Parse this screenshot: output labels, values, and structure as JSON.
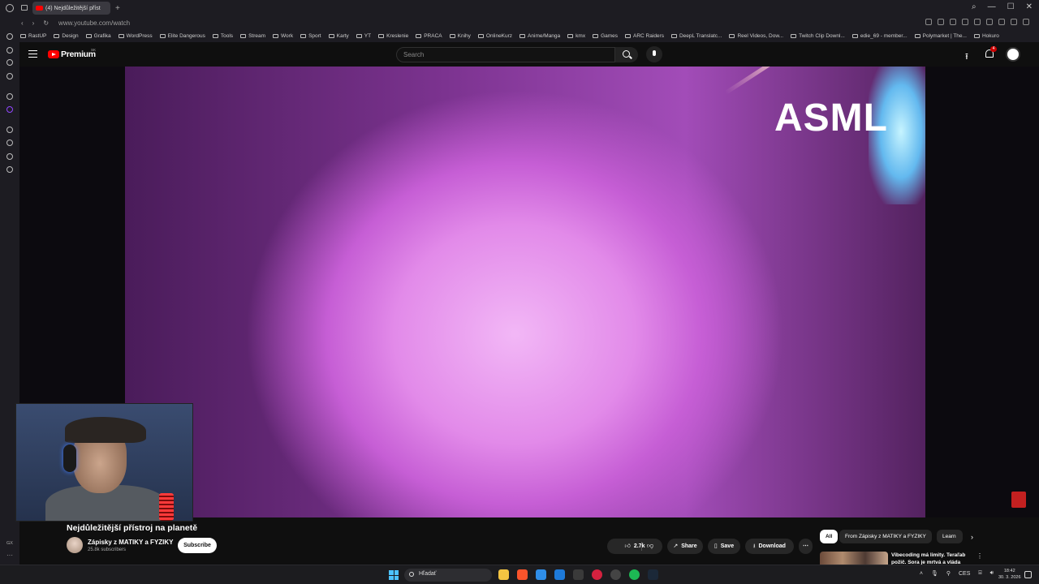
{
  "browser": {
    "tab_title": "(4) Nejdůležitější příst",
    "new_tab": "+",
    "url": "www.youtube.com/watch",
    "window_controls": [
      "⌕",
      "—",
      "☐",
      "✕"
    ],
    "bookmarks": [
      "RastUP",
      "Design",
      "Grafika",
      "WordPress",
      "Elite Dangerous",
      "Tools",
      "Stream",
      "Work",
      "Sport",
      "Karty",
      "YT",
      "Kreslenie",
      "PRACA",
      "Knihy",
      "OnlineKurz",
      "Anime/Manga",
      "kmx",
      "Games",
      "ARC Raiders",
      "DeepL Translatc...",
      "Reel Videos, Dow...",
      "Twitch Clip Downl...",
      "edie_69 - member...",
      "Polymarket | The...",
      "Hokuro"
    ]
  },
  "youtube": {
    "brand": "Premium",
    "region": "SK",
    "search_placeholder": "Search",
    "notification_count": "4",
    "video_overlay_text": "ASML",
    "video": {
      "title": "Nejdůležitější přístroj na planetě",
      "channel": "Zápisky z MATIKY a FYZIKY",
      "subscribers": "25.8k subscribers",
      "subscribe_label": "Subscribe",
      "likes": "2.7k",
      "share_label": "Share",
      "save_label": "Save",
      "download_label": "Download"
    },
    "chips": [
      "All",
      "From Zápisky z MATIKY a FYZIKY",
      "Learn"
    ],
    "recommendation_title": "Vibecoding má limity. Teraľab požič. Sora je mrtvá a vláda"
  },
  "sidebar_bottom": {
    "label": "GX",
    "more": "···"
  },
  "taskbar": {
    "search_placeholder": "Hľadať",
    "language": "CES",
    "time": "18:42",
    "date": "30. 3. 2026"
  },
  "colors": {
    "youtube_red": "#ff0000",
    "background": "#0f0f0f",
    "windows_accent": "#4cc2ff"
  }
}
